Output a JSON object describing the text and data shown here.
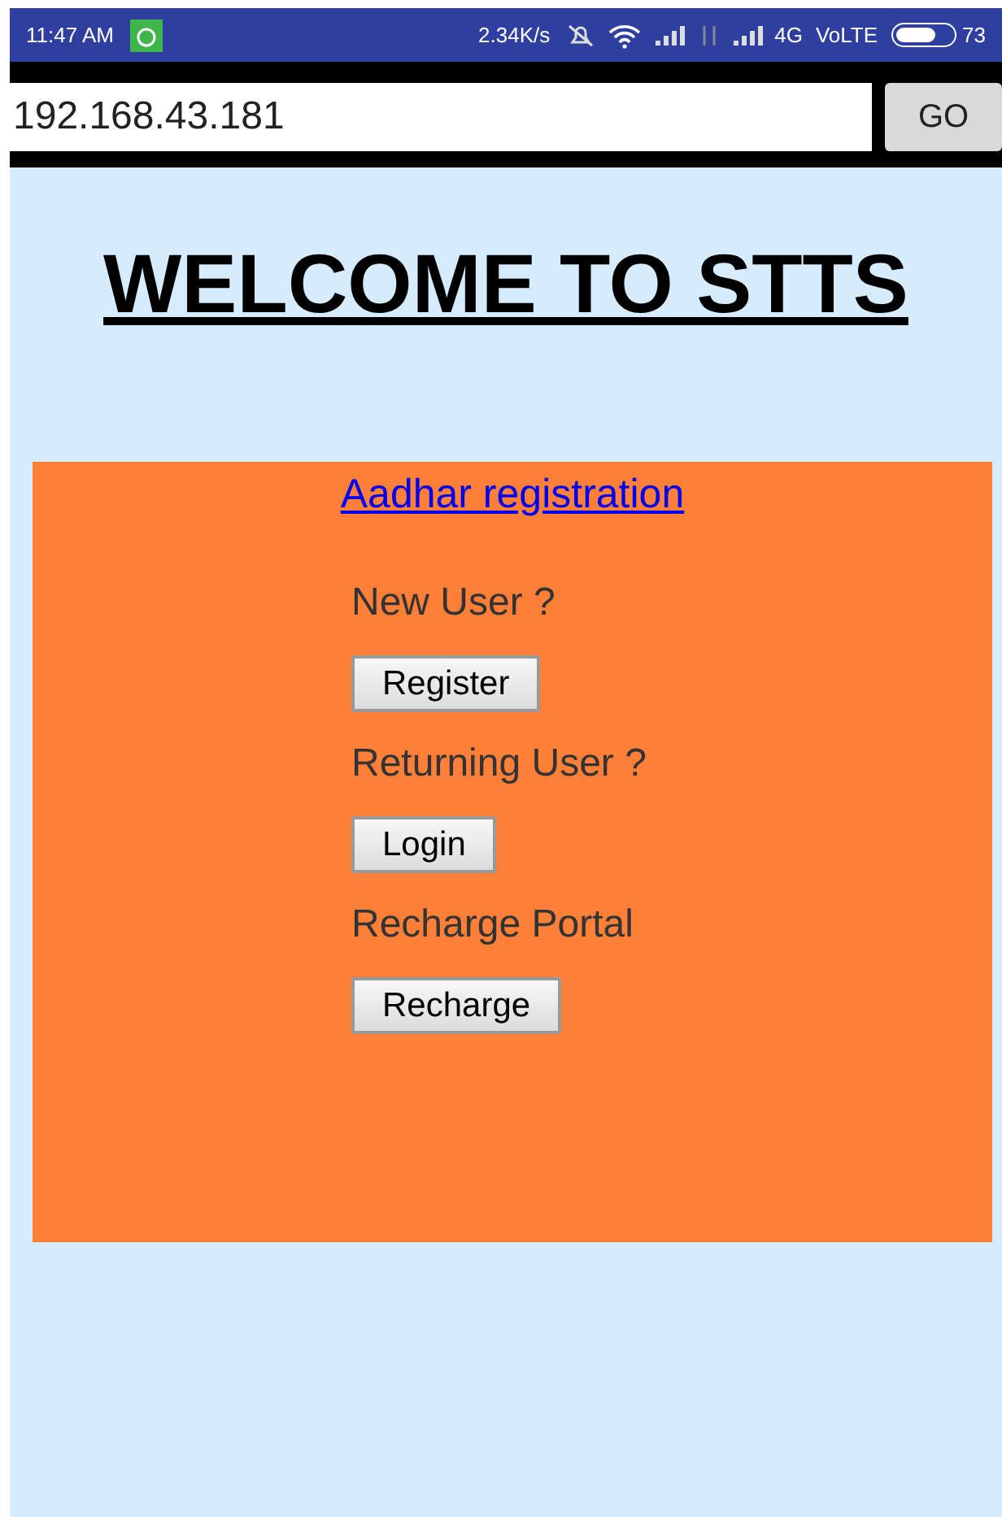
{
  "status_bar": {
    "time": "11:47 AM",
    "speed": "2.34K/s",
    "network": "4G",
    "volte": "VoLTE",
    "battery_percent": "73"
  },
  "address_bar": {
    "value": "192.168.43.181",
    "go_button": "GO"
  },
  "page": {
    "heading": "WELCOME TO STTS",
    "panel": {
      "link": "Aadhar registration",
      "items": [
        {
          "label": "New User ?",
          "button": "Register"
        },
        {
          "label": "Returning User ?",
          "button": "Login"
        },
        {
          "label": "Recharge Portal",
          "button": "Recharge"
        }
      ]
    }
  }
}
